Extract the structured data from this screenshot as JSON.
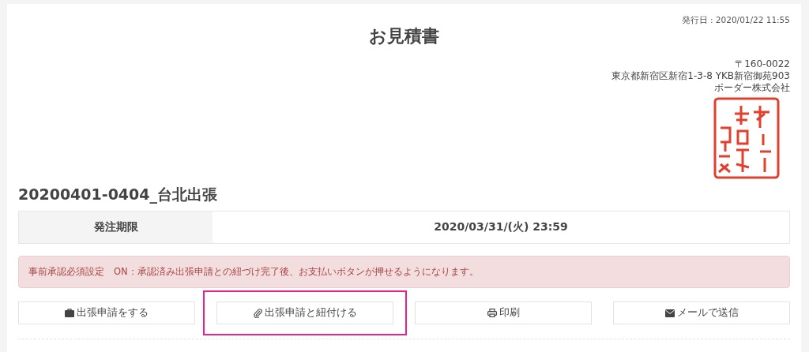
{
  "issue_date": "発行日 : 2020/01/22 11:55",
  "title": "お見積書",
  "issuer": {
    "postal_code": "〒160-0022",
    "address": "東京都新宿区新宿1-3-8 YKB新宿御苑903",
    "company": "ボーダー株式会社"
  },
  "trip_name": "20200401-0404_台北出張",
  "deadline": {
    "label": "発注期限",
    "value": "2020/03/31/(火) 23:59"
  },
  "alert": "事前承認必須設定　ON：承認済み出張申請との紐づけ完了後、お支払いボタンが押せるようになります。",
  "buttons": [
    {
      "kind": "briefcase",
      "label": "出張申請をする",
      "highlighted": false
    },
    {
      "kind": "paperclip",
      "label": "出張申請と紐付ける",
      "highlighted": true
    },
    {
      "kind": "printer",
      "label": "印刷",
      "highlighted": false
    },
    {
      "kind": "envelope",
      "label": "メールで送信",
      "highlighted": false
    }
  ]
}
